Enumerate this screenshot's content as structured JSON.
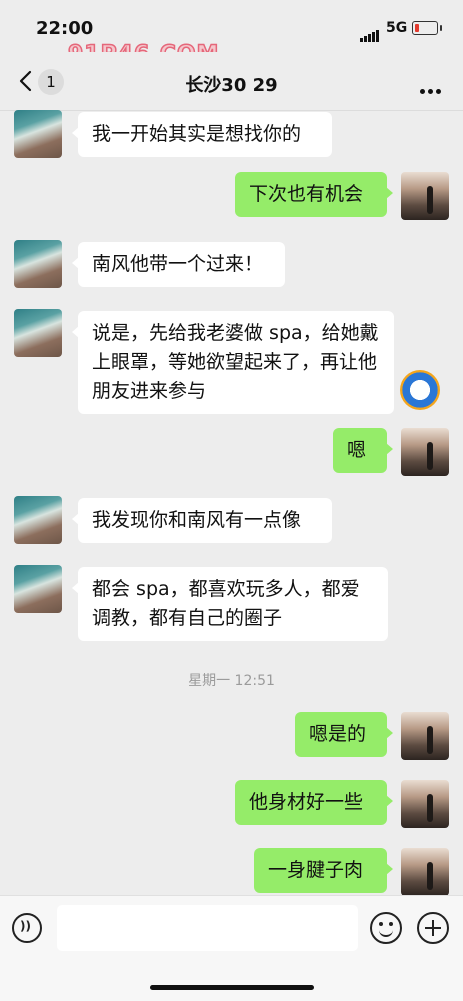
{
  "status": {
    "time": "22:00",
    "network": "5G"
  },
  "watermark": "91P46.COM",
  "header": {
    "unread_count": "1",
    "title": "长沙30 29"
  },
  "messages": [
    {
      "side": "left",
      "text": "我一开始其实是想找你的"
    },
    {
      "side": "right",
      "text": "下次也有机会"
    },
    {
      "side": "left",
      "text": "南风他带一个过来！"
    },
    {
      "side": "left",
      "text": "说是，先给我老婆做 spa，给她戴上眼罩，等她欲望起来了，再让他朋友进来参与"
    },
    {
      "side": "right",
      "text": "嗯"
    },
    {
      "side": "left",
      "text": "我发现你和南风有一点像"
    },
    {
      "side": "left",
      "text": "都会 spa，都喜欢玩多人，都爱调教，都有自己的圈子"
    },
    {
      "side": "right",
      "text": "嗯是的"
    },
    {
      "side": "right",
      "text": "他身材好一些"
    },
    {
      "side": "right",
      "text": "一身腱子肉"
    }
  ],
  "timestamp": "星期一 12:51"
}
